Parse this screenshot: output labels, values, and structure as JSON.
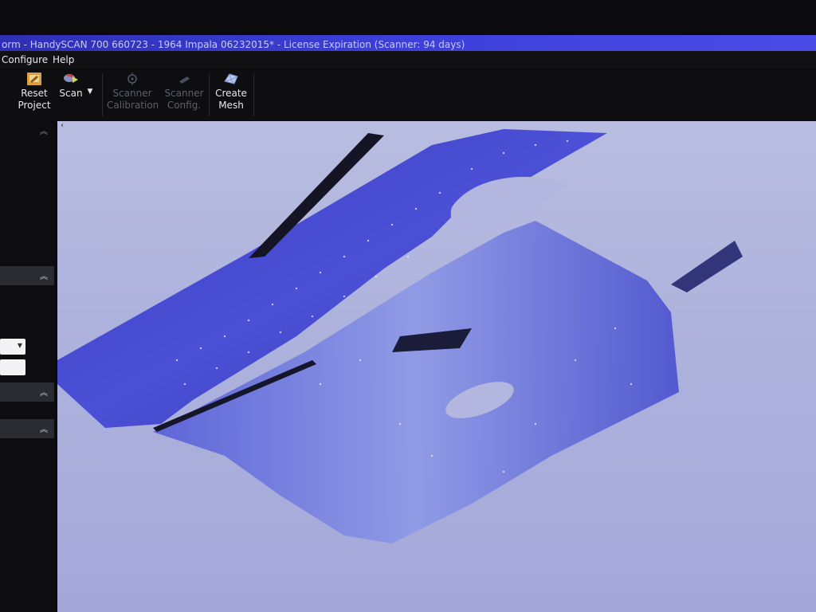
{
  "window": {
    "title": "orm - HandySCAN 700 660723 - 1964 Impala 06232015* - License Expiration (Scanner: 94 days)"
  },
  "menu": {
    "items": [
      "Configure",
      "Help"
    ]
  },
  "toolbar": {
    "reset_project": {
      "line1": "Reset",
      "line2": "Project",
      "icon": "reset-project-icon"
    },
    "scan": {
      "label": "Scan",
      "icon": "scan-icon"
    },
    "scanner_calibration": {
      "line1": "Scanner",
      "line2": "Calibration",
      "icon": "calibration-icon"
    },
    "scanner_config": {
      "line1": "Scanner",
      "line2": "Config.",
      "icon": "scanner-config-icon"
    },
    "create_mesh": {
      "line1": "Create",
      "line2": "Mesh",
      "icon": "create-mesh-icon"
    }
  },
  "colors": {
    "title_bar": "#3b3fd6",
    "viewport_bg": "#aeb3dd",
    "scan_surface": "#3f43c8",
    "disabled_text": "#5d5f6c"
  },
  "viewport": {
    "content": "3d-scan-mesh"
  }
}
